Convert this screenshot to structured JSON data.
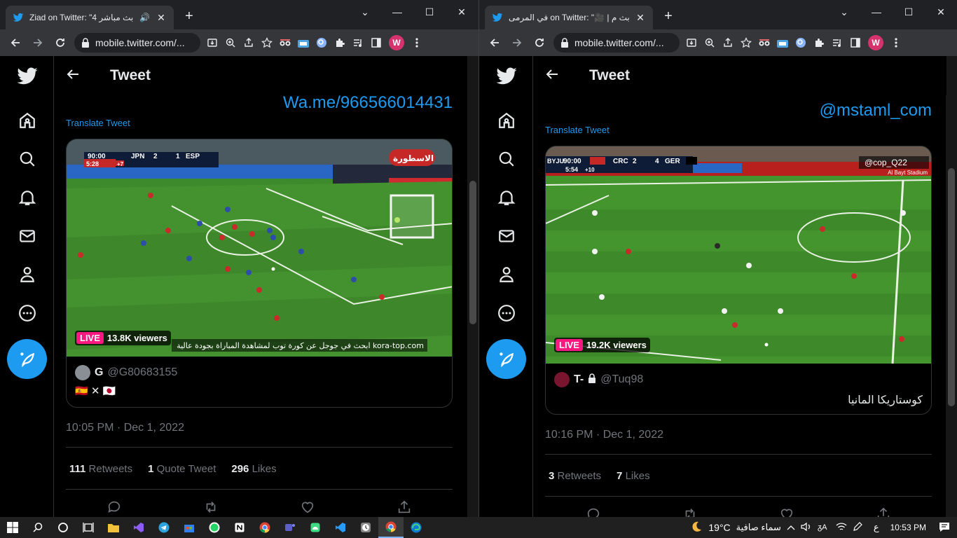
{
  "left": {
    "tab_title": "Ziad on Twitter: \"4 بث مباشر",
    "url": "mobile.twitter.com/...",
    "header_title": "Tweet",
    "link_line": "Wa.me/966566014431",
    "translate": "Translate Tweet",
    "scoreboard": {
      "time": "90:00",
      "team1": "JPN",
      "score1": "2",
      "score2": "1",
      "team2": "ESP",
      "clock": "5:28",
      "extra": "+7"
    },
    "channel_logo": "الاسطورة",
    "live_label": "LIVE",
    "viewers": "13.8K viewers",
    "subtitle": "ابحث في جوجل عن كورة توب لمشاهدة المباراة بجودة عالية kora-top.com",
    "quote_name": "G",
    "quote_handle": "@G80683155",
    "quote_text": "🇪🇸 ✕ 🇯🇵",
    "timestamp": "10:05 PM · Dec 1, 2022",
    "retweets_n": "111",
    "retweets_l": "Retweets",
    "quotes_n": "1",
    "quotes_l": "Quote Tweet",
    "likes_n": "296",
    "likes_l": "Likes"
  },
  "right": {
    "tab_title": "في المرمى on Twitter: \"🎥 | بث م",
    "url": "mobile.twitter.com/...",
    "header_title": "Tweet",
    "link_line": "@mstaml_com",
    "translate": "Translate Tweet",
    "scoreboard": {
      "sponsor": "BYJU",
      "time": "90:00",
      "team1": "CRC",
      "score1": "2",
      "score2": "4",
      "team2": "GER",
      "clock": "5:54",
      "extra": "+10"
    },
    "watermark": "@cop_Q22",
    "stadium": "Al Bayt Stadium",
    "live_label": "LIVE",
    "viewers": "19.2K viewers",
    "quote_name": "T-",
    "quote_handle": "@Tuq98",
    "quote_text": "كوستاريكا المانيا",
    "timestamp": "10:16 PM · Dec 1, 2022",
    "retweets_n": "3",
    "retweets_l": "Retweets",
    "likes_n": "7",
    "likes_l": "Likes"
  },
  "taskbar": {
    "weather_temp": "19°C",
    "weather_desc": "سماء صافية",
    "lang": "ع",
    "time": "10:53 PM"
  },
  "colors": {
    "twitter_blue": "#1d9bf0",
    "live_pink": "#f91880",
    "pitch": "#3f8a2e"
  }
}
